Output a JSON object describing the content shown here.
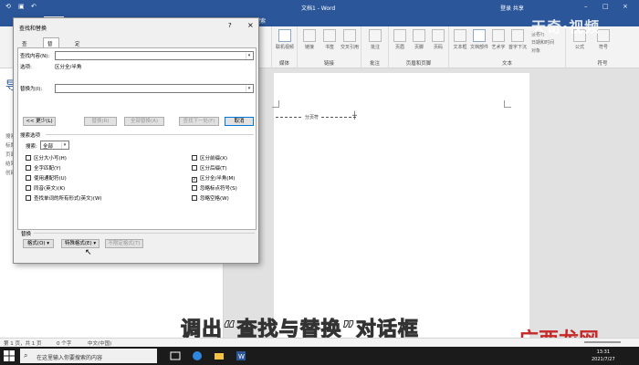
{
  "window": {
    "title": "文档1 - Word",
    "account": "登录 共享"
  },
  "tell_me": "操作说明搜索",
  "ribbon": {
    "groups": [
      {
        "label": "",
        "buttons": []
      },
      {
        "label": "媒体",
        "buttons": [
          "联机视频"
        ]
      },
      {
        "label": "链接",
        "buttons": [
          "链接",
          "书签",
          "交叉引用"
        ]
      },
      {
        "label": "批注",
        "buttons": [
          "批注"
        ]
      },
      {
        "label": "页眉和页脚",
        "buttons": [
          "页眉",
          "页脚",
          "页码"
        ]
      },
      {
        "label": "文本",
        "buttons": [
          "文本框",
          "文档部件",
          "艺术字",
          "首字下沉"
        ]
      },
      {
        "label": "符号",
        "buttons": [
          "公式",
          "符号"
        ]
      }
    ],
    "small_items": [
      "签名行",
      "日期和时间",
      "对象"
    ]
  },
  "watermark": "天奇·视频",
  "nav_pane": {
    "heading": "导",
    "lines": [
      "搜索",
      "标题",
      "页面",
      "结果",
      "创建",
      "若要",
      "样式"
    ]
  },
  "document": {
    "section_break": "分页符"
  },
  "dialog": {
    "title": "查找和替换",
    "help": "?",
    "close": "×",
    "tabs": [
      "查找(D)",
      "替换(P)",
      "定位(G)"
    ],
    "active_tab": 1,
    "find_label": "查找内容(N):",
    "find_value": "",
    "options_label": "选项:",
    "options_value": "区分全/半角",
    "replace_label": "替换为(I):",
    "replace_value": "",
    "buttons": {
      "less": "<< 更少(L)",
      "replace": "替换(R)",
      "replace_all": "全部替换(A)",
      "find_next": "查找下一处(F)",
      "cancel": "取消"
    },
    "search_options_title": "搜索选项",
    "search_label": "搜索:",
    "search_value": "全部",
    "left_checks": [
      {
        "label": "区分大小写(H)",
        "checked": false
      },
      {
        "label": "全字匹配(Y)",
        "checked": false
      },
      {
        "label": "使用通配符(U)",
        "checked": false
      },
      {
        "label": "同音(英文)(K)",
        "checked": false
      },
      {
        "label": "查找单词的所有形式(英文)(W)",
        "checked": false
      }
    ],
    "right_checks": [
      {
        "label": "区分前缀(X)",
        "checked": false
      },
      {
        "label": "区分后缀(T)",
        "checked": false
      },
      {
        "label": "区分全/半角(M)",
        "checked": true
      },
      {
        "label": "忽略标点符号(S)",
        "checked": false
      },
      {
        "label": "忽略空格(W)",
        "checked": false
      }
    ],
    "replace_section": "替换",
    "format_btn": "格式(O) ▾",
    "special_btn": "特殊格式(E) ▾",
    "no_format_btn": "不限定格式(T)"
  },
  "statusbar": {
    "page": "第 1 页，共 1 页",
    "words": "0 个字",
    "lang": "中文(中国)"
  },
  "taskbar": {
    "search_placeholder": "在这里输入你要搜索的内容",
    "time": "13:31",
    "date": "2021/7/27"
  },
  "subtitle": "调出“查找与替换”对话框",
  "sitemark": "广西龙网"
}
